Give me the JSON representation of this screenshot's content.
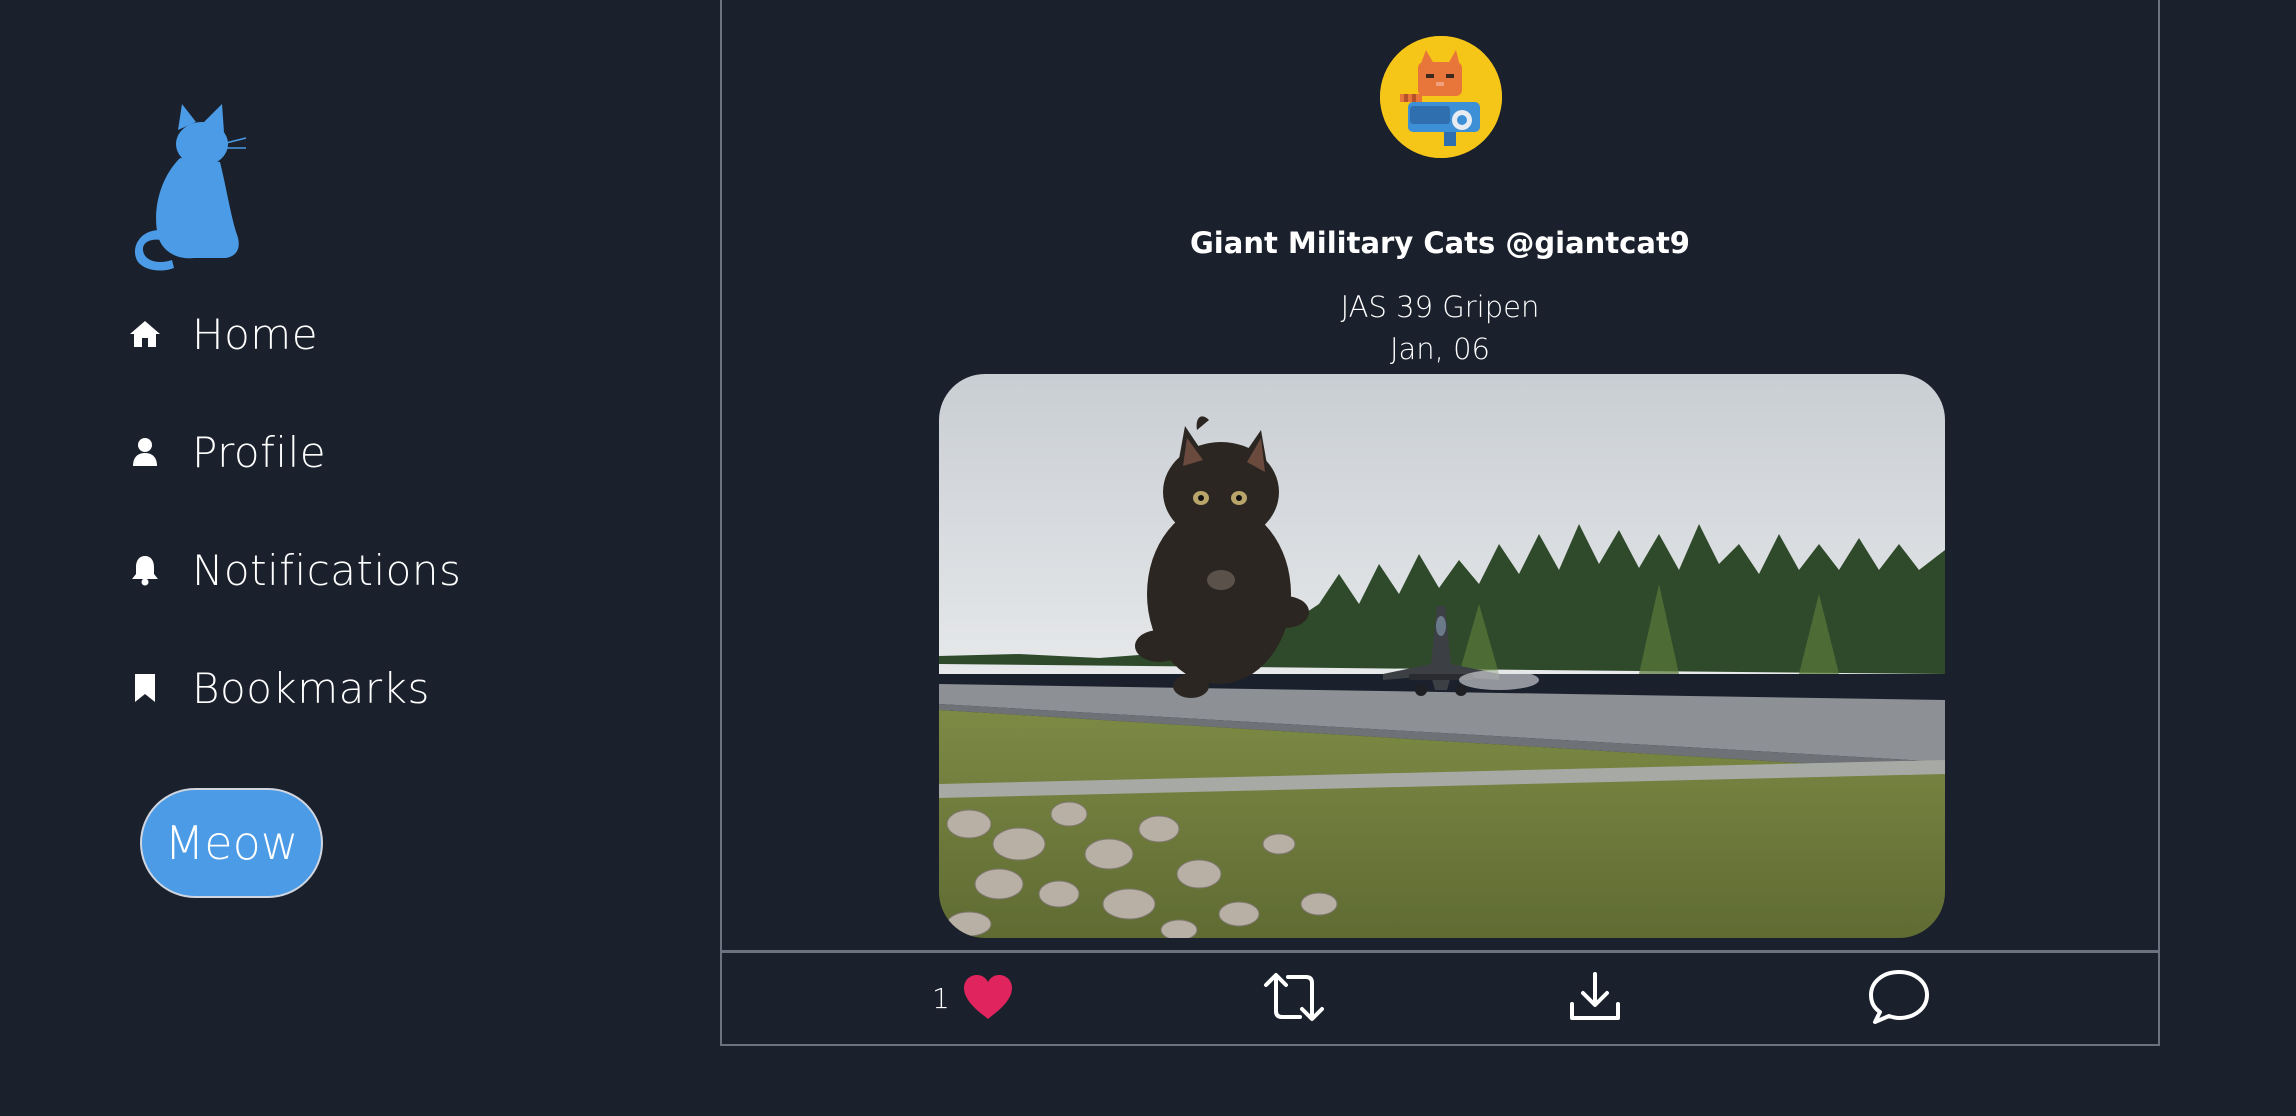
{
  "sidebar": {
    "logo_icon": "cat-silhouette-icon",
    "nav": [
      {
        "label": "Home",
        "icon": "home-icon"
      },
      {
        "label": "Profile",
        "icon": "user-icon"
      },
      {
        "label": "Notifications",
        "icon": "bell-icon"
      },
      {
        "label": "Bookmarks",
        "icon": "bookmark-icon"
      }
    ],
    "compose_label": "Meow"
  },
  "post": {
    "author": "Giant Military Cats @giantcat9",
    "text": "JAS 39 Gripen",
    "date": "Jan, 06",
    "image_icon": "cat-and-fighter-jet-photo",
    "actions": {
      "like_count": "1",
      "like_icon": "heart-icon",
      "retweet_icon": "retweet-icon",
      "download_icon": "download-icon",
      "comment_icon": "comment-icon"
    }
  },
  "colors": {
    "background": "#1a202c",
    "accent": "#4b9be6",
    "like": "#e0245e",
    "border": "#6b7280"
  }
}
